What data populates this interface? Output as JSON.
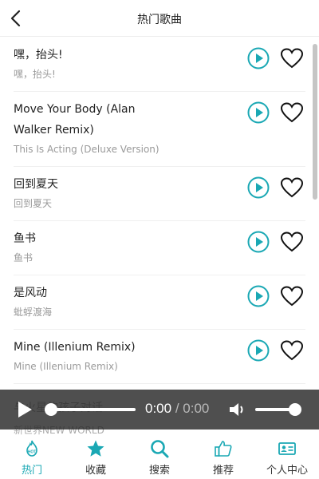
{
  "header": {
    "title": "热门歌曲"
  },
  "songs": [
    {
      "name": "嘿，抬头!",
      "artist": "嘿，抬头!"
    },
    {
      "name": "Move Your Body (Alan Walker Remix)",
      "artist": "This Is Acting (Deluxe Version)"
    },
    {
      "name": "回到夏天",
      "artist": "回到夏天"
    },
    {
      "name": "鱼书",
      "artist": "鱼书"
    },
    {
      "name": "是风动",
      "artist": "蚍蜉渡海"
    },
    {
      "name": "Mine (Illenium Remix)",
      "artist": "Mine (Illenium Remix)"
    }
  ],
  "partial_song": {
    "name": "与火星的孩子对话",
    "artist": "新世界NEW WORLD"
  },
  "player": {
    "current_time": "0:00",
    "separator": "/",
    "total_time": "0:00",
    "progress": 0,
    "volume": 1
  },
  "tabs": [
    {
      "label": "热门",
      "icon": "hot-icon",
      "active": true
    },
    {
      "label": "收藏",
      "icon": "star-icon",
      "active": false
    },
    {
      "label": "搜索",
      "icon": "search-icon",
      "active": false
    },
    {
      "label": "推荐",
      "icon": "thumbs-up-icon",
      "active": false
    },
    {
      "label": "个人中心",
      "icon": "profile-card-icon",
      "active": false
    }
  ],
  "colors": {
    "accent": "#1aa8b4",
    "player_bg": "#282828"
  }
}
